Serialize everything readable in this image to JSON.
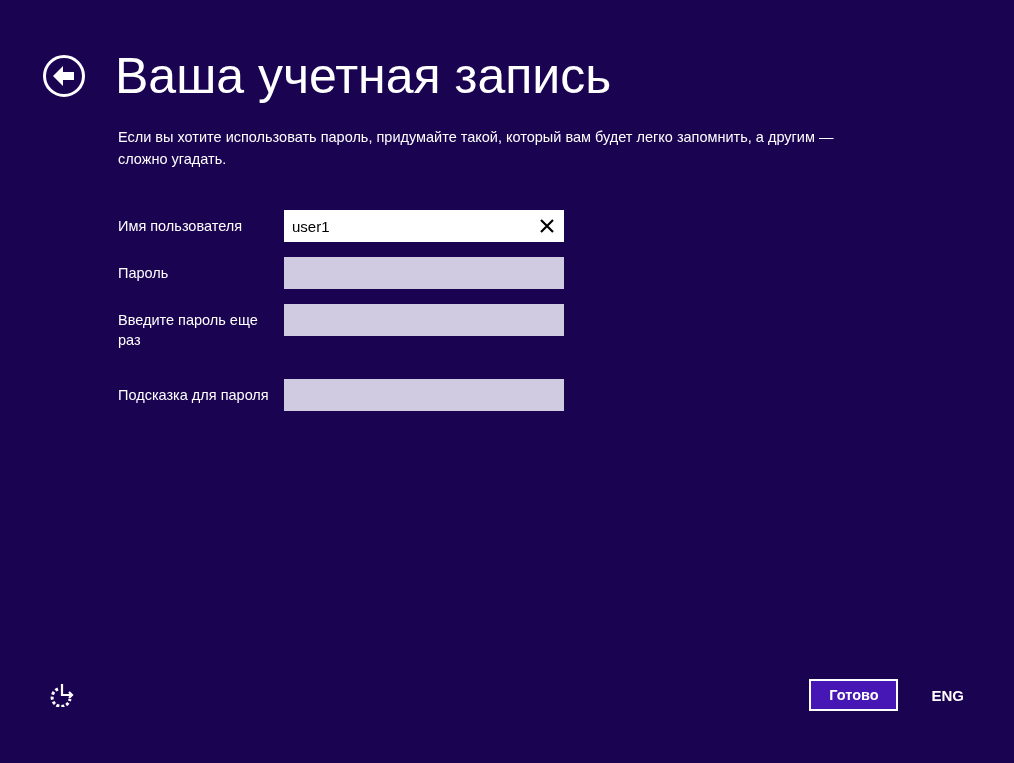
{
  "title": "Ваша учетная запись",
  "description": "Если вы хотите использовать пароль, придумайте такой, который вам будет легко запомнить, а другим — сложно угадать.",
  "fields": [
    {
      "label": "Имя пользователя",
      "value": "user1",
      "focused": true
    },
    {
      "label": "Пароль",
      "focused": false
    },
    {
      "label": "Введите пароль еще раз",
      "focused": false
    },
    {
      "label": "Подсказка для пароля",
      "focused": false
    }
  ],
  "footer": {
    "button": "Готово",
    "language": "ENG"
  }
}
